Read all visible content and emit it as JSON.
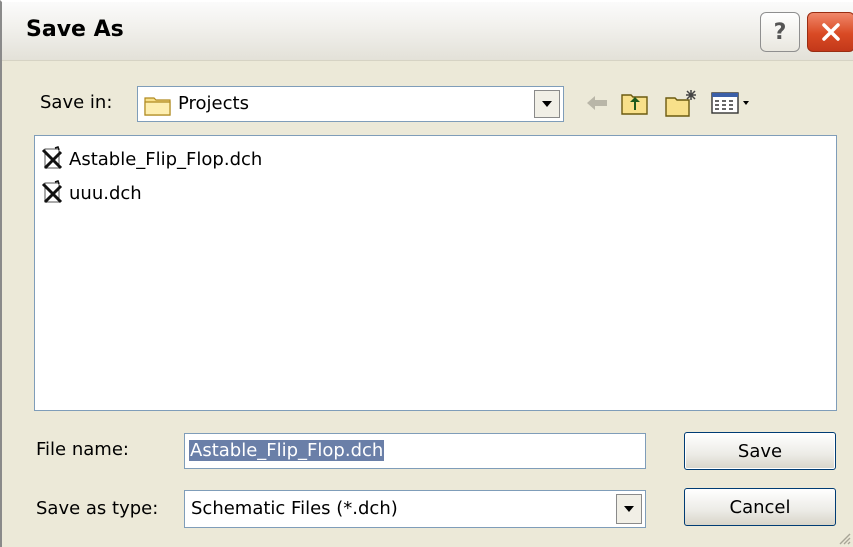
{
  "window": {
    "title": "Save As",
    "help_label": "?",
    "icons": {
      "help": "question-mark-icon",
      "close": "close-x-icon"
    }
  },
  "toolbar": {
    "save_in_label": "Save in:",
    "location": "Projects",
    "location_icon": "folder-icon",
    "icons": [
      "back-arrow-icon",
      "up-one-level-icon",
      "create-new-folder-icon",
      "view-menu-icon"
    ]
  },
  "files": [
    {
      "name": "Astable_Flip_Flop.dch",
      "icon": "schematic-file-icon"
    },
    {
      "name": "uuu.dch",
      "icon": "schematic-file-icon"
    }
  ],
  "form": {
    "file_name_label": "File name:",
    "file_name_value": "Astable_Flip_Flop.dch",
    "save_as_type_label": "Save as type:",
    "save_as_type_value": "Schematic Files (*.dch)"
  },
  "buttons": {
    "save": "Save",
    "cancel": "Cancel"
  },
  "colors": {
    "dialog_bg": "#ece9d8",
    "selection_bg": "#6a7fa8",
    "close_button": "#d94a24",
    "field_border": "#7f9db9"
  }
}
